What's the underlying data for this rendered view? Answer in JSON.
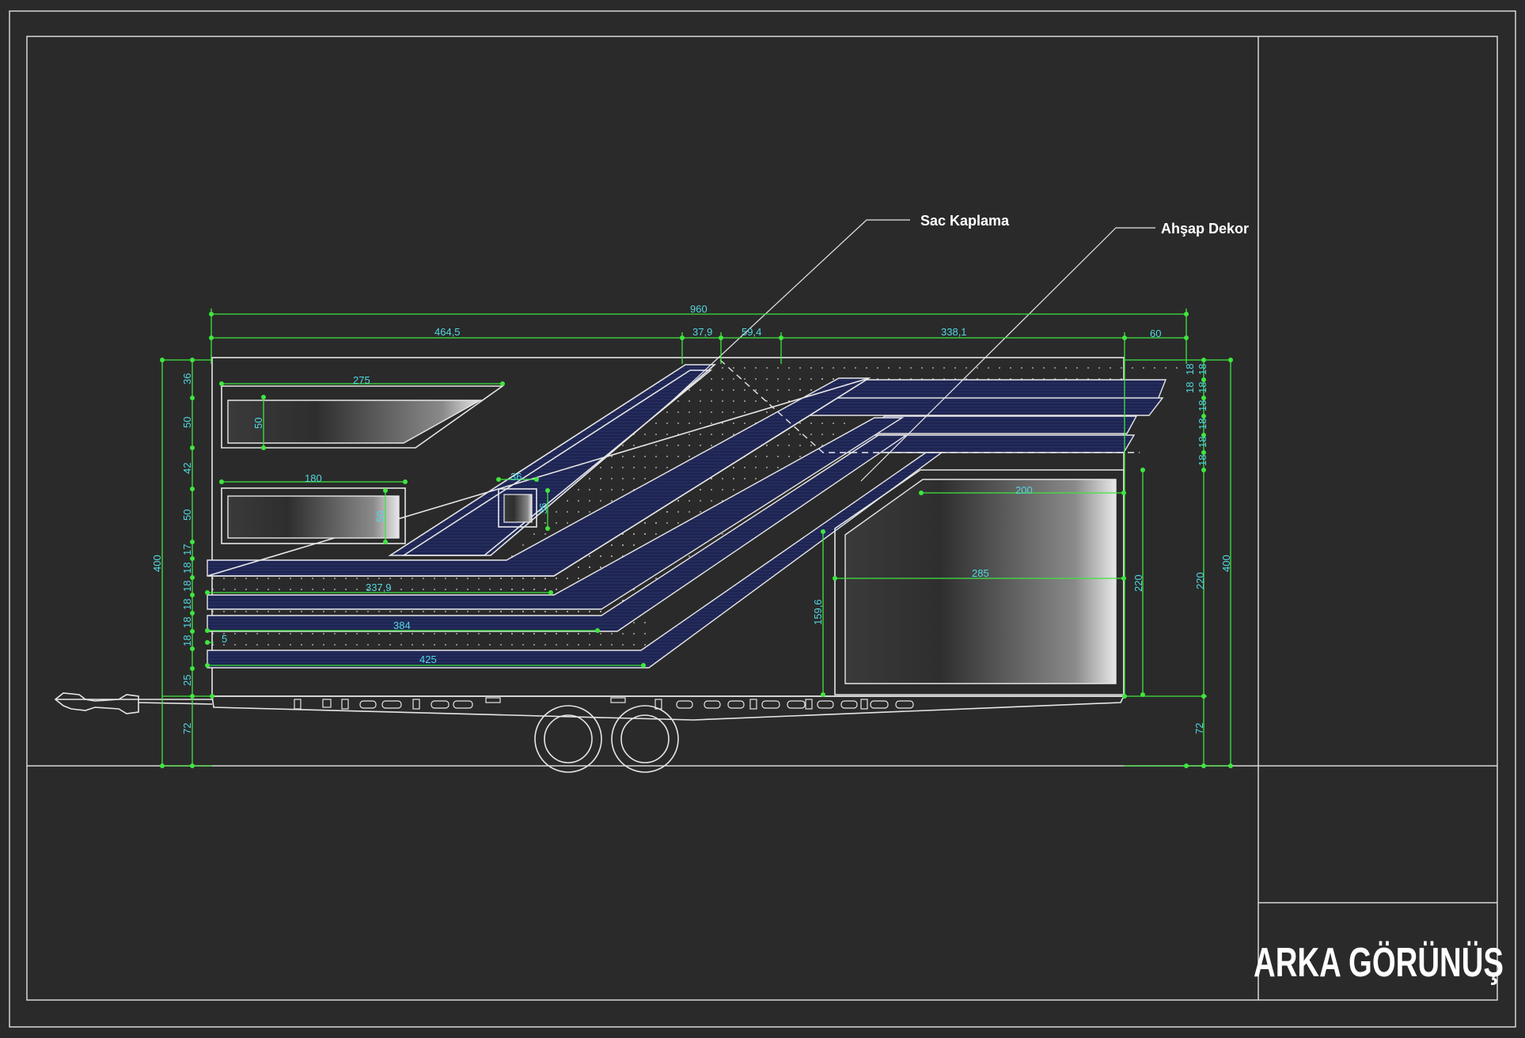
{
  "title": "ARKA GÖRÜNÜŞ",
  "labels": {
    "sac_kaplama": "Sac Kaplama",
    "ahsap_dekor": "Ahşap Dekor"
  },
  "dimensions": {
    "overall_width": "960",
    "seg_1": "464,5",
    "seg_2": "37,9",
    "seg_3": "59,4",
    "seg_4": "338,1",
    "seg_5": "60",
    "win1_width": "275",
    "win1_height": "50",
    "win2_width": "180",
    "win2_height": "50",
    "small_win_w": "36",
    "small_win_h": "36",
    "door_width": "200",
    "door_inner": "285",
    "door_height": "220",
    "door_height_r": "220",
    "door_left_h": "159,6",
    "band_1": "337,9",
    "band_2": "384",
    "band_3": "425",
    "inset": "5",
    "total_height_l": "400",
    "total_height_r": "400",
    "chassis_l": "72",
    "chassis_r": "72",
    "left_stack": [
      "36",
      "50",
      "42",
      "50",
      "17",
      "18",
      "18",
      "18",
      "18",
      "18",
      "25"
    ],
    "right_stack": [
      "18",
      "18",
      "18",
      "18",
      "18",
      "18",
      "18",
      "18"
    ]
  },
  "colors": {
    "background": "#2a2a2a",
    "line": "#e6e6e6",
    "dimension": "#3fe63f",
    "dimension_text": "#52d8e0",
    "panel_blue": "#1b2a66"
  }
}
